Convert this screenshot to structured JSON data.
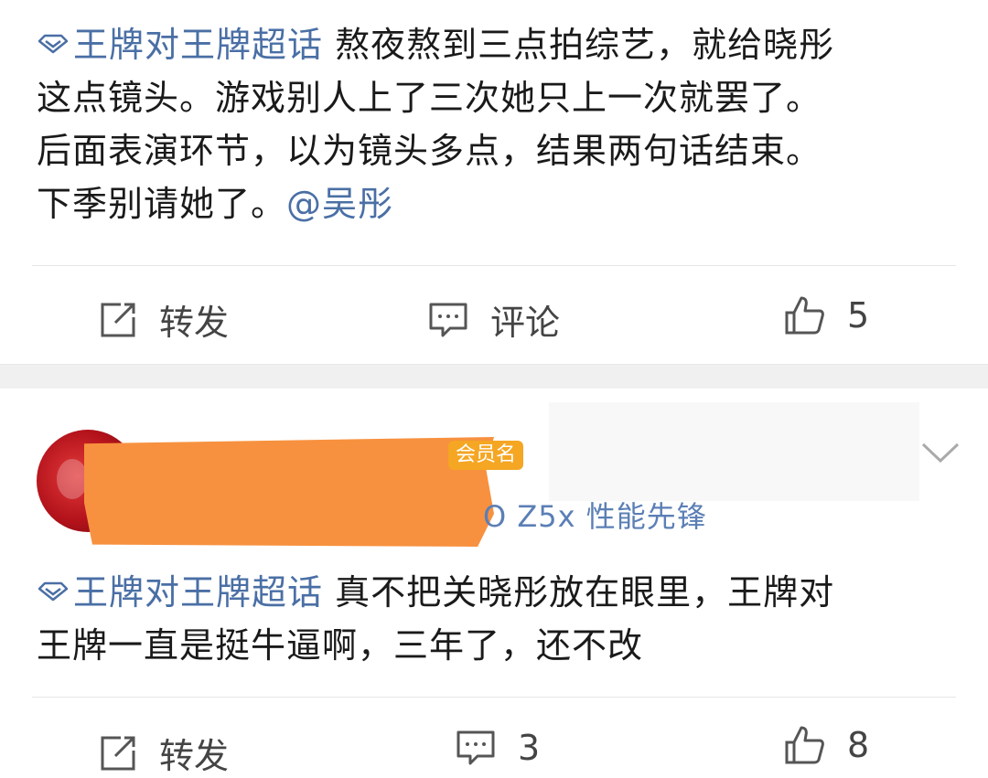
{
  "post1": {
    "topic": "王牌对王牌超话",
    "text_line1": " 熬夜熬到三点拍综艺，就给晓彤",
    "text_line2": "这点镜头。游戏别人上了三次她只上一次就罢了。",
    "text_line3": "后面表演环节，以为镜头多点，结果两句话结束。",
    "text_line4": "下季别请她了。",
    "mention": "@吴彤",
    "actions": {
      "repost": "转发",
      "comment": "评论",
      "like_count": "5"
    }
  },
  "post2": {
    "badge": "会员名",
    "device": "O Z5x 性能先锋",
    "topic": "王牌对王牌超话",
    "text_line1": " 真不把关晓彤放在眼里，王牌对",
    "text_line2": "王牌一直是挺牛逼啊，三年了，还不改",
    "actions": {
      "repost": "转发",
      "comment_count": "3",
      "like_count": "8"
    }
  },
  "colors": {
    "link": "#4a6fa5",
    "redaction": "#f7913f",
    "badge": "#f5a623"
  },
  "icons": [
    "diamond-topic-icon",
    "repost-icon",
    "comment-icon",
    "like-icon",
    "chevron-down-icon"
  ]
}
